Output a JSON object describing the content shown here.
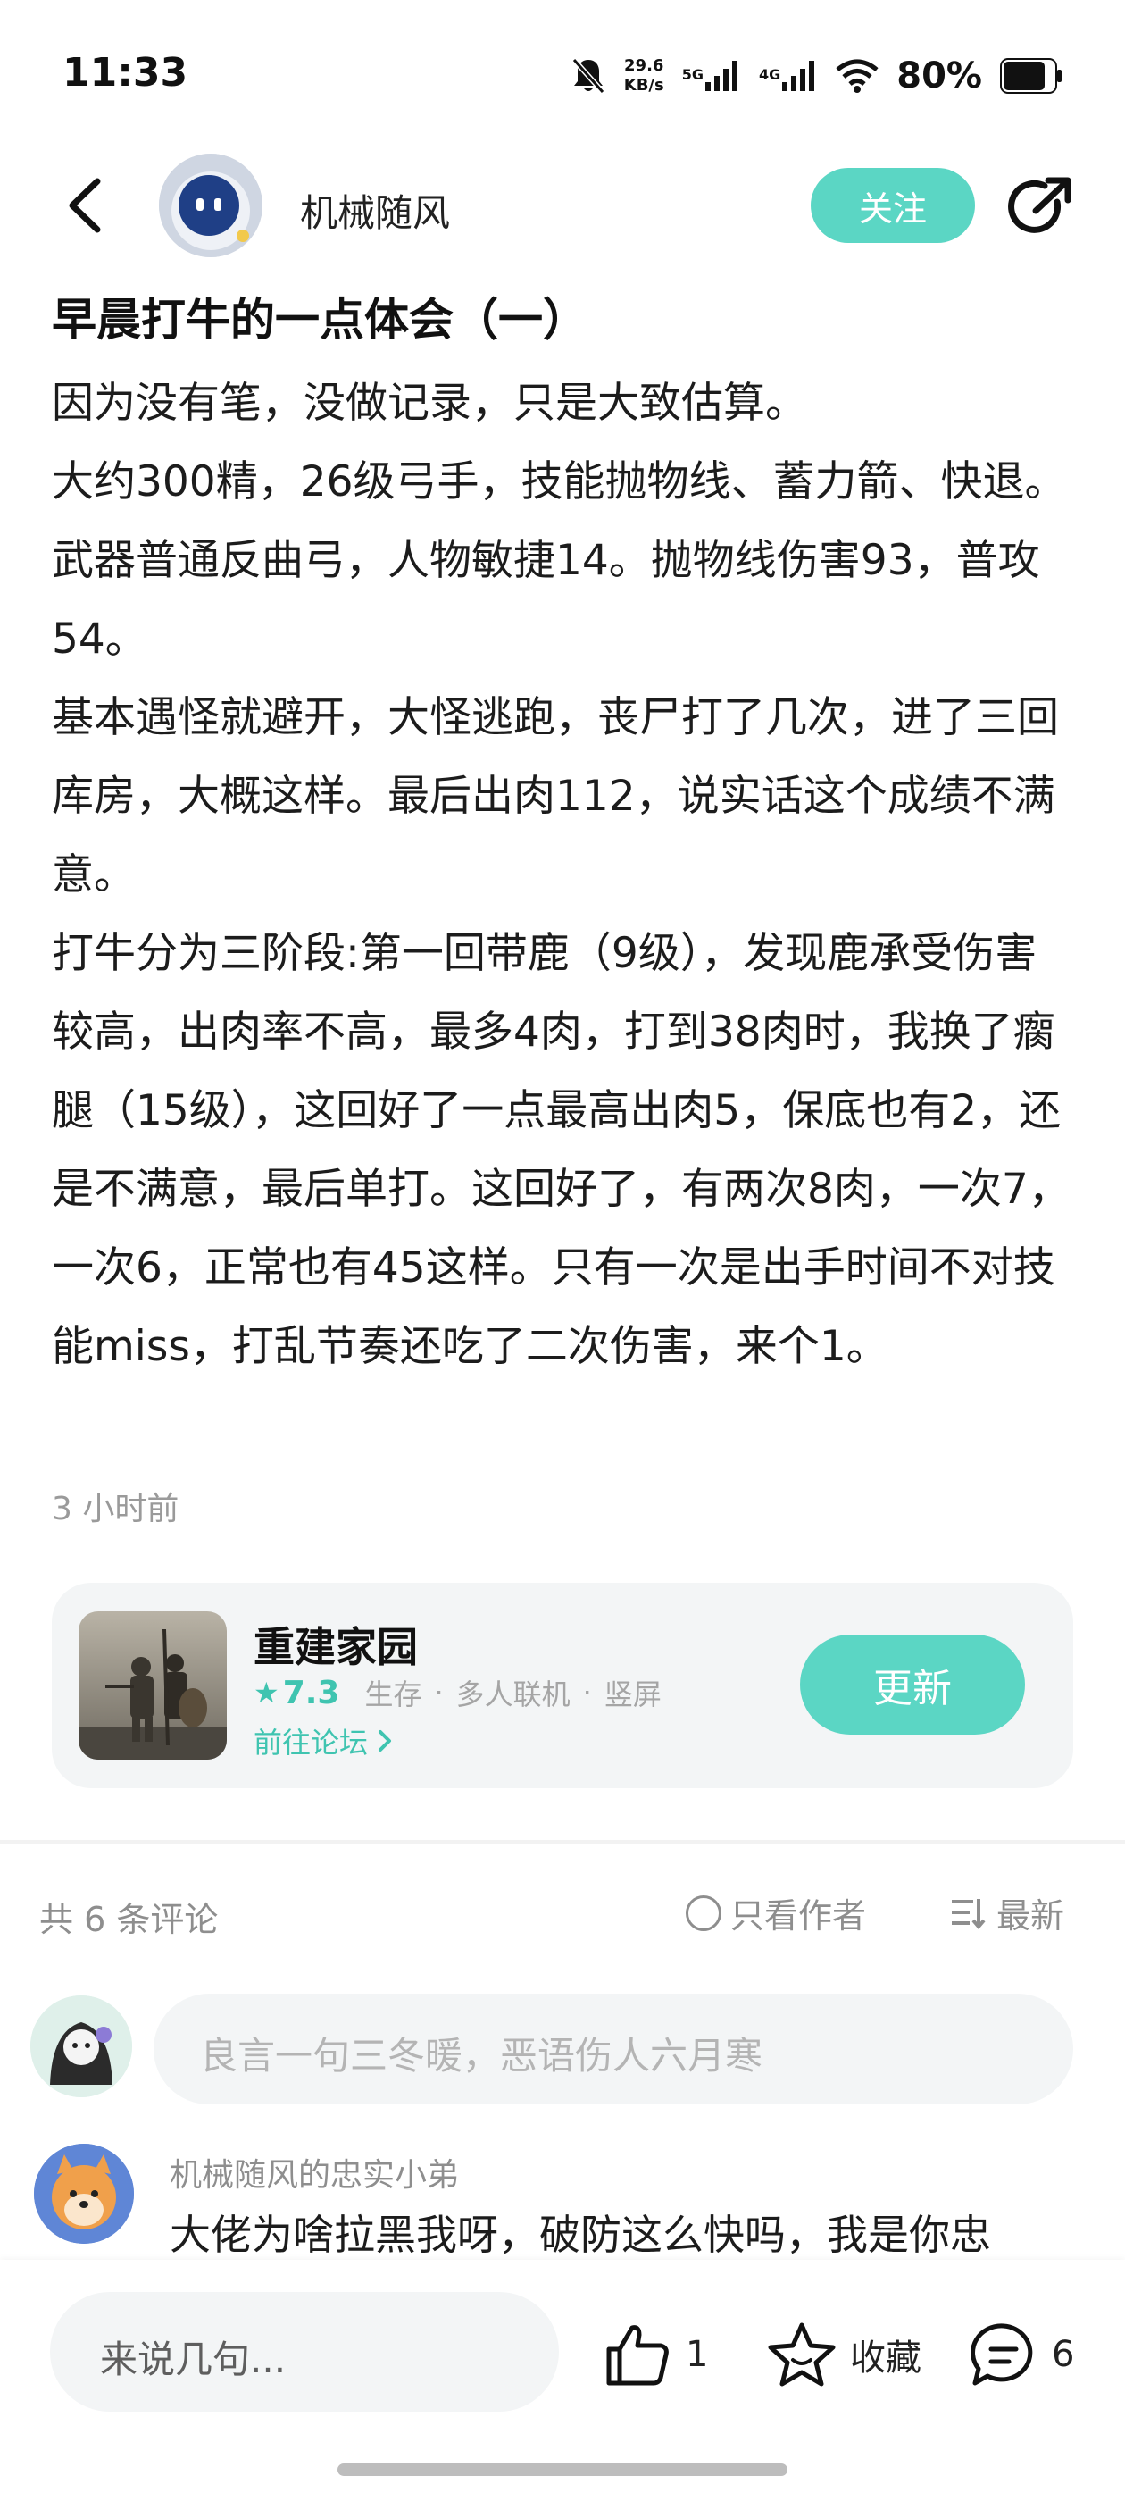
{
  "status_bar": {
    "time": "11:33",
    "net_speed_value": "29.6",
    "net_speed_unit": "KB/s",
    "signal1_label": "5G",
    "signal2_label": "4G",
    "battery": "80%"
  },
  "header": {
    "author_name": "机械随风",
    "follow_label": "关注"
  },
  "post": {
    "title": "早晨打牛的一点体会（一）",
    "paragraphs": [
      "因为没有笔，没做记录，只是大致估算。",
      "大约300精，26级弓手，技能抛物线、蓄力箭、快退。武器普通反曲弓，人物敏捷14。抛物线伤害93，普攻54。",
      "基本遇怪就避开，大怪逃跑，丧尸打了几次，进了三回库房，大概这样。最后出肉112，说实话这个成绩不满意。",
      "打牛分为三阶段:第一回带鹿（9级），发现鹿承受伤害较高，出肉率不高，最多4肉，打到38肉时，我换了瘸腿（15级），这回好了一点最高出肉5，保底也有2，还是不满意，最后单打。这回好了，有两次8肉，一次7，一次6，正常也有45这样。只有一次是出手时间不对技能miss，打乱节奏还吃了二次伤害，来个1。"
    ],
    "time_ago": "3 小时前"
  },
  "game_card": {
    "name": "重建家园",
    "rating": "7.3",
    "tags": [
      "生存",
      "多人联机",
      "竖屏"
    ],
    "forum_link": "前往论坛",
    "update_label": "更新"
  },
  "comments": {
    "count_label": "共 6 条评论",
    "author_only_label": "只看作者",
    "sort_label": "最新",
    "input_placeholder": "良言一句三冬暖，恶语伤人六月寒",
    "items": [
      {
        "author": "机械随风的忠实小弟",
        "text": "大佬为啥拉黑我呀，破防这么快吗，我是你忠"
      }
    ]
  },
  "bottom_bar": {
    "input_placeholder": "来说几句...",
    "like_count": "1",
    "favorite_label": "收藏",
    "comment_count": "6"
  },
  "colors": {
    "accent": "#5bd6c4",
    "accent_text": "#3fc4b0",
    "muted_text": "#8e8e8e",
    "card_bg": "#f3f5f6"
  },
  "icons": [
    "back-arrow-icon",
    "share-icon",
    "mute-bell-icon",
    "signal-icon",
    "wifi-icon",
    "battery-icon",
    "star-icon",
    "chevron-right-icon",
    "radio-icon",
    "sort-icon",
    "thumbs-up-icon",
    "star-outline-icon",
    "chat-bubble-icon"
  ]
}
